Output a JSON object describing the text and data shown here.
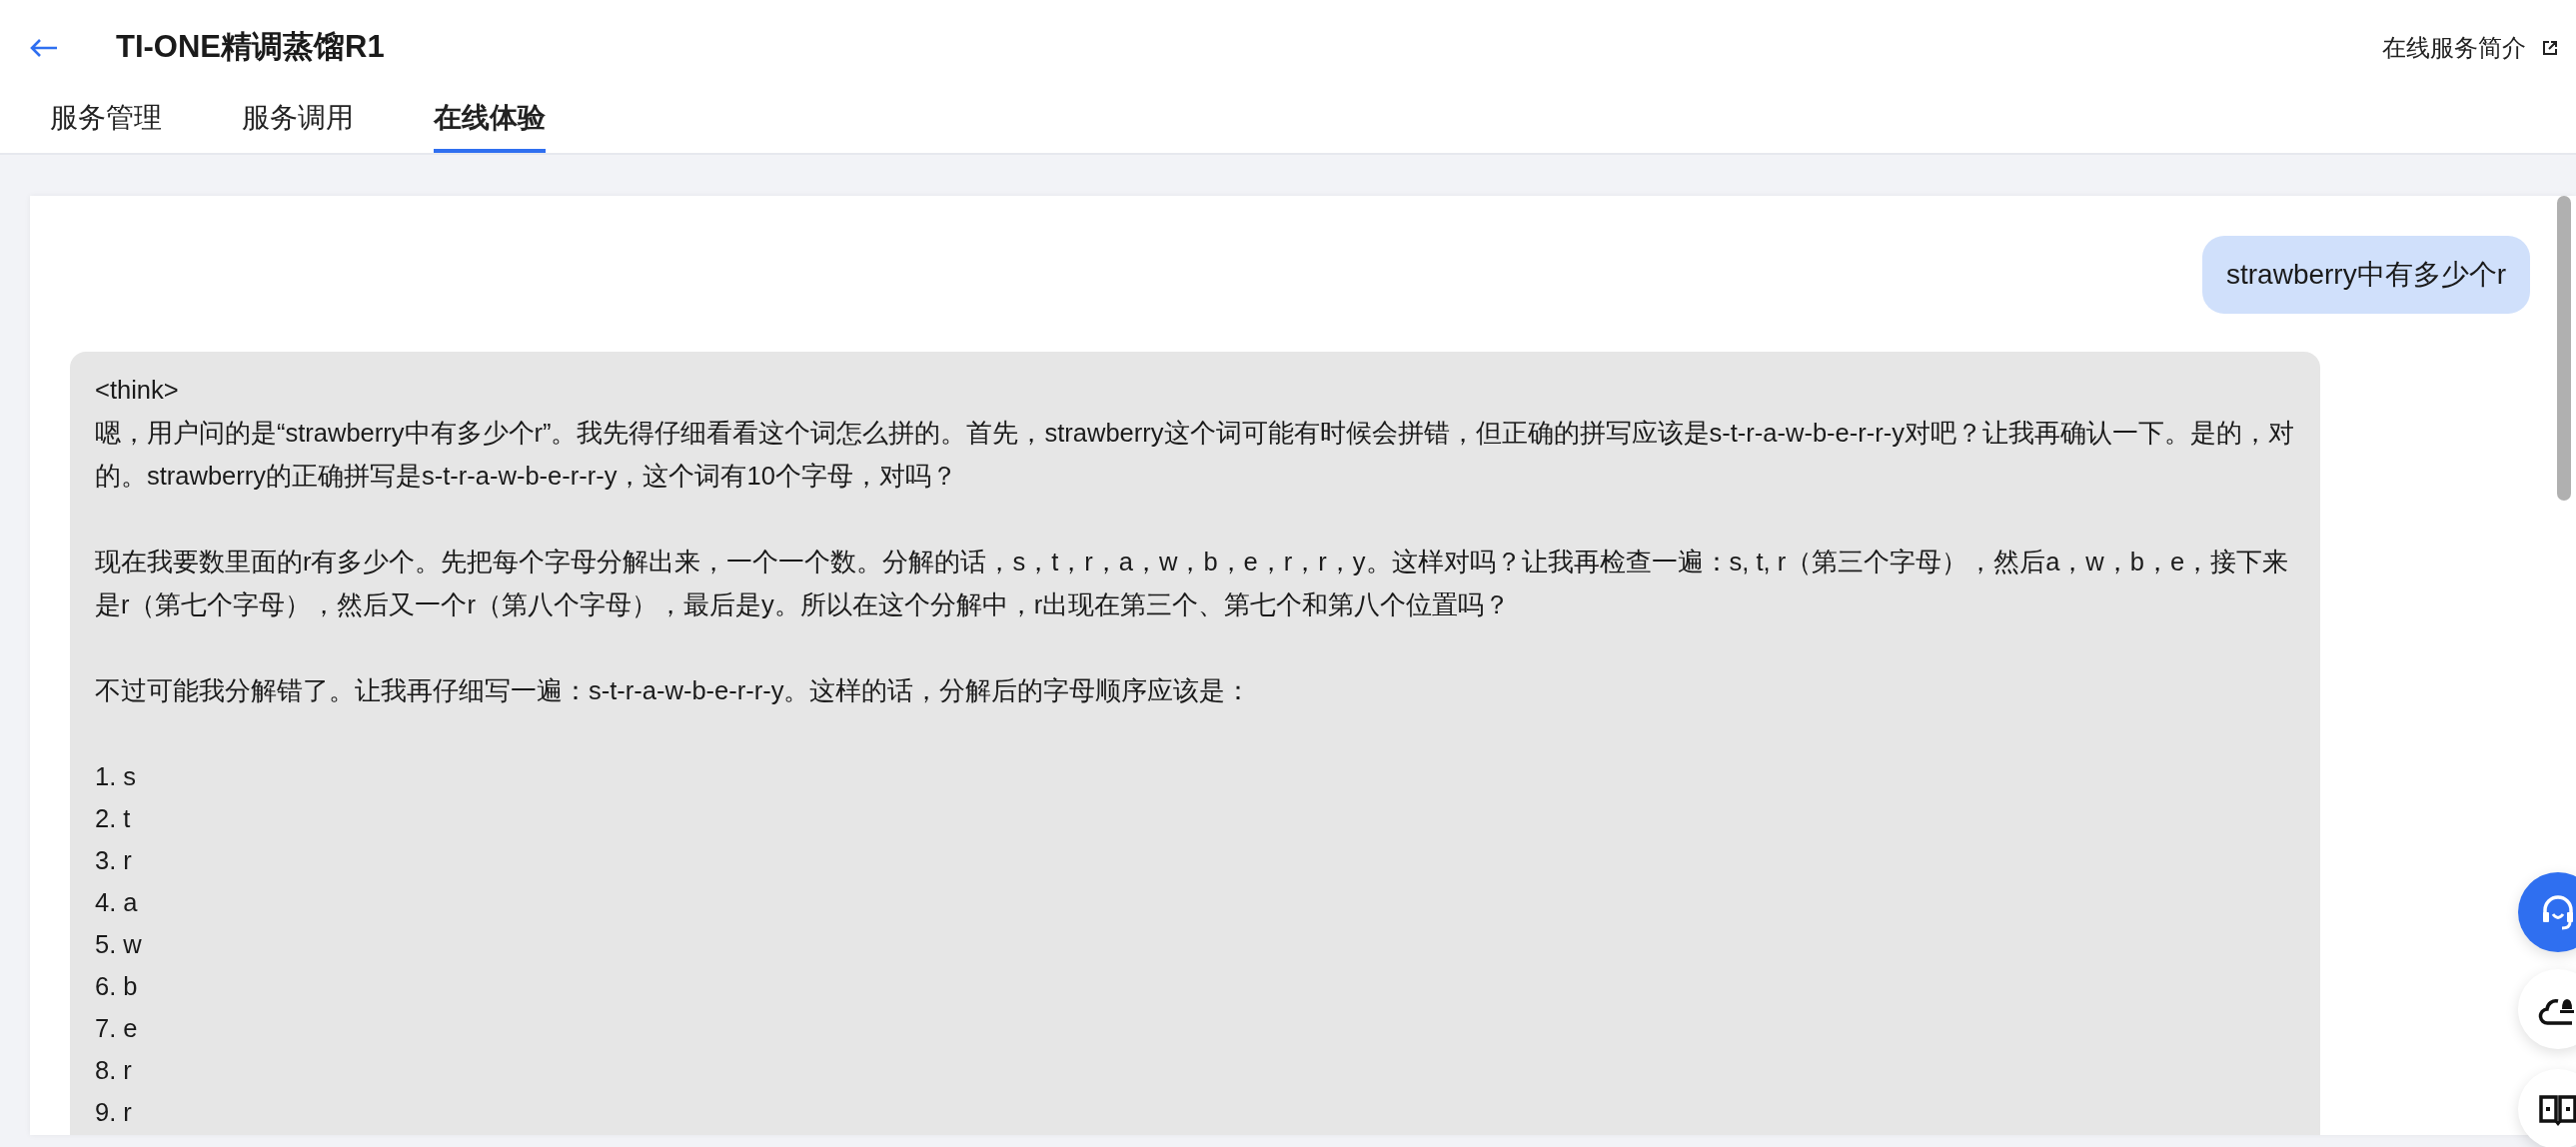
{
  "page": {
    "title": "TI-ONE精调蒸馏R1",
    "help_link": "在线服务简介"
  },
  "tabs": [
    {
      "label": "服务管理",
      "selected": false
    },
    {
      "label": "服务调用",
      "selected": false
    },
    {
      "label": "在线体验",
      "selected": true
    }
  ],
  "chat": {
    "messages": [
      {
        "kind": "user",
        "text": "strawberry中有多少个r"
      },
      {
        "kind": "assistant",
        "blocks": [
          {
            "kind": "tag",
            "text": "<think>"
          },
          {
            "kind": "para",
            "text": "嗯，用户问的是“strawberry中有多少个r”。我先得仔细看看这个词怎么拼的。首先，strawberry这个词可能有时候会拼错，但正确的拼写应该是s-t-r-a-w-b-e-r-r-y对吧？让我再确认一下。是的，对的。strawberry的正确拼写是s-t-r-a-w-b-e-r-r-y，这个词有10个字母，对吗？"
          },
          {
            "kind": "para",
            "text": "现在我要数里面的r有多少个。先把每个字母分解出来，一个一个数。分解的话，s，t，r，a，w，b，e，r，r，y。这样对吗？让我再检查一遍：s, t, r（第三个字母），然后a，w，b，e，接下来是r（第七个字母），然后又一个r（第八个字母），最后是y。所以在这个分解中，r出现在第三个、第七个和第八个位置吗？"
          },
          {
            "kind": "para",
            "text": "不过可能我分解错了。让我再仔细写一遍：s-t-r-a-w-b-e-r-r-y。这样的话，分解后的字母顺序应该是："
          },
          {
            "kind": "list",
            "items": [
              "1. s",
              "2. t",
              "3. r",
              "4. a",
              "5. w",
              "6. b",
              "7. e",
              "8. r",
              "9. r"
            ]
          }
        ]
      }
    ]
  },
  "float_buttons": [
    {
      "kind": "headset",
      "selected": true
    },
    {
      "kind": "cloud-bell",
      "selected": false
    },
    {
      "kind": "book",
      "selected": false
    }
  ]
}
